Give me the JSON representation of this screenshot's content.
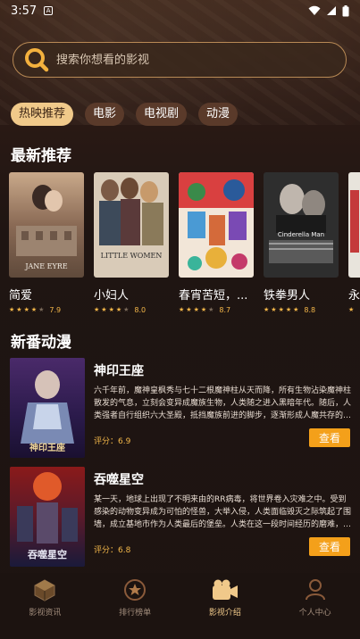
{
  "status_bar": {
    "time": "3:57"
  },
  "search": {
    "placeholder": "搜索你想看的影视"
  },
  "categories": [
    {
      "label": "热映推荐",
      "active": true
    },
    {
      "label": "电影",
      "active": false
    },
    {
      "label": "电视剧",
      "active": false
    },
    {
      "label": "动漫",
      "active": false
    }
  ],
  "sections": {
    "latest": "最新推荐",
    "anime": "新番动漫"
  },
  "latest": [
    {
      "title": "简爱",
      "score": "7.9",
      "stars": 4,
      "poster_text": "JANE EYRE"
    },
    {
      "title": "小妇人",
      "score": "8.0",
      "stars": 4,
      "poster_text": "LITTLE WOMEN"
    },
    {
      "title": "春宵苦短，...",
      "score": "8.7",
      "stars": 4,
      "poster_text": ""
    },
    {
      "title": "铁拳男人",
      "score": "8.8",
      "stars": 5,
      "poster_text": "Cinderella Man"
    },
    {
      "title": "永",
      "score": "",
      "stars": 1,
      "poster_text": ""
    }
  ],
  "anime": [
    {
      "title": "神印王座",
      "desc": "六千年前，魔神皇枫秀与七十二根魔神柱从天而降，所有生物沾染魔神柱散发的气息，立刻会变异成魔族生物，人类随之进入黑暗年代。随后，人类强者自行组织六大圣殿，抵挡魔族前进的脚步，逐渐形成人魔共存的…",
      "score_label": "评分：6.9",
      "button": "查看",
      "poster_text": "神印王座"
    },
    {
      "title": "吞噬星空",
      "desc": "某一天，地球上出现了不明来由的RR病毒，将世界卷入灾难之中。受到感染的动物变异成为可怕的怪兽，大举入侵，人类面临毁灭之际筑起了围墙，成立基地市作为人类最后的堡垒。人类在这一段时间经历的磨难，…",
      "score_label": "评分：6.8",
      "button": "查看",
      "poster_text": "吞噬星空"
    }
  ],
  "tabs": [
    {
      "label": "影视资讯",
      "icon": "cube-icon",
      "active": false
    },
    {
      "label": "排行榜单",
      "icon": "ranking-icon",
      "active": false
    },
    {
      "label": "影视介绍",
      "icon": "video-camera-icon",
      "active": true
    },
    {
      "label": "个人中心",
      "icon": "user-icon",
      "active": false
    }
  ],
  "colors": {
    "accent": "#f0c98a",
    "button": "#f4a01a",
    "star": "#f5b84a",
    "background": "#1f1411"
  }
}
